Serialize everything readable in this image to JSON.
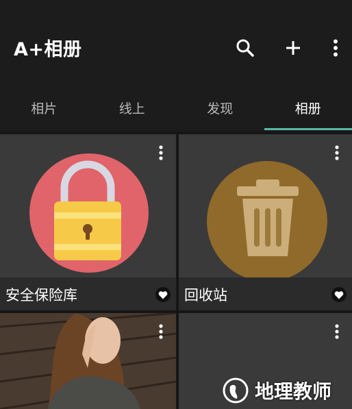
{
  "app": {
    "title": "A+相册"
  },
  "toolbar": {
    "search_icon": "search-icon",
    "add_icon": "plus-icon",
    "more_icon": "more-vert-icon"
  },
  "tabs": [
    {
      "label": "相片",
      "active": false
    },
    {
      "label": "线上",
      "active": false
    },
    {
      "label": "发现",
      "active": false
    },
    {
      "label": "相册",
      "active": true
    }
  ],
  "albums": [
    {
      "label": "安全保险库",
      "icon": "lock-icon",
      "favorite": true
    },
    {
      "label": "回收站",
      "icon": "trash-icon",
      "favorite": true
    },
    {
      "label": "",
      "icon": "photo-thumbnail",
      "favorite": false
    },
    {
      "label": "",
      "icon": "empty",
      "favorite": false
    }
  ],
  "watermark": {
    "text": "地理教师"
  },
  "colors": {
    "accent": "#5ab9a8",
    "vault_circle": "#e0646a",
    "trash_circle": "#8f6a2a"
  }
}
